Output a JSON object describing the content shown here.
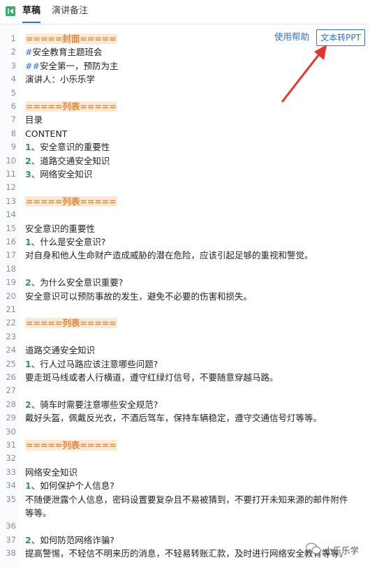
{
  "tabs": [
    {
      "label": "草稿"
    },
    {
      "label": "演讲备注"
    }
  ],
  "toolbar": {
    "help_label": "使用帮助",
    "convert_label": "文本转PPT"
  },
  "watermark": "小乐乐学",
  "lines": [
    {
      "n": "1",
      "t": "=====封面=====",
      "type": "banner"
    },
    {
      "n": "2",
      "pre": "#",
      "t": "安全教育主题班会",
      "type": "hd"
    },
    {
      "n": "3",
      "pre": "##",
      "t": "安全第一，预防为主",
      "type": "hd"
    },
    {
      "n": "4",
      "t": "演讲人：小乐乐学"
    },
    {
      "n": "5",
      "t": ""
    },
    {
      "n": "6",
      "t": "=====列表=====",
      "type": "banner"
    },
    {
      "n": "7",
      "t": "目录"
    },
    {
      "n": "8",
      "t": "CONTENT"
    },
    {
      "n": "9",
      "pre": "1、",
      "t": "安全意识的重要性",
      "type": "mk"
    },
    {
      "n": "10",
      "pre": "2、",
      "t": "道路交通安全知识",
      "type": "mk"
    },
    {
      "n": "11",
      "pre": "3、",
      "t": "网络安全知识",
      "type": "mk"
    },
    {
      "n": "12",
      "t": ""
    },
    {
      "n": "13",
      "t": "=====列表=====",
      "type": "banner"
    },
    {
      "n": "14",
      "t": ""
    },
    {
      "n": "15",
      "t": "安全意识的重要性"
    },
    {
      "n": "16",
      "pre": "1、",
      "t": "什么是安全意识?",
      "type": "mk"
    },
    {
      "n": "17",
      "t": "对自身和他人生命财产造成威胁的潜在危险，应该引起足够的重视和警觉。"
    },
    {
      "n": "18",
      "t": ""
    },
    {
      "n": "19",
      "pre": "2、",
      "t": "为什么安全意识重要?",
      "type": "mk"
    },
    {
      "n": "20",
      "t": "安全意识可以预防事故的发生，避免不必要的伤害和损失。"
    },
    {
      "n": "21",
      "t": ""
    },
    {
      "n": "22",
      "t": "=====列表=====",
      "type": "banner"
    },
    {
      "n": "23",
      "t": ""
    },
    {
      "n": "24",
      "t": "道路交通安全知识"
    },
    {
      "n": "25",
      "pre": "1、",
      "t": "行人过马路应该注意哪些问题?",
      "type": "mk"
    },
    {
      "n": "26",
      "t": "要走斑马线或者人行横道，遵守红绿灯信号，不要随意穿越马路。"
    },
    {
      "n": "27",
      "t": ""
    },
    {
      "n": "28",
      "pre": "2、",
      "t": "骑车时需要注意哪些安全规范?",
      "type": "mk"
    },
    {
      "n": "29",
      "t": "戴好头盔，佩戴反光衣，不酒后驾车，保持车辆稳定，遵守交通信号灯等等。"
    },
    {
      "n": "30",
      "t": ""
    },
    {
      "n": "31",
      "t": "=====列表=====",
      "type": "banner"
    },
    {
      "n": "32",
      "t": ""
    },
    {
      "n": "33",
      "t": "网络安全知识"
    },
    {
      "n": "34",
      "pre": "1、",
      "t": "如何保护个人信息?",
      "type": "mk"
    },
    {
      "n": "35",
      "t": "不随便泄露个人信息，密码设置要复杂且不易被猜到，不要打开未知来源的邮件附件"
    },
    {
      "n": "",
      "t": "等等。"
    },
    {
      "n": "36",
      "t": ""
    },
    {
      "n": "37",
      "pre": "2、",
      "t": "如何防范网络诈骗?",
      "type": "mk"
    },
    {
      "n": "38",
      "t": "提高警惕，不轻信不明来历的消息，不轻易转账汇款，及时进行网络安全教育等等。"
    }
  ]
}
